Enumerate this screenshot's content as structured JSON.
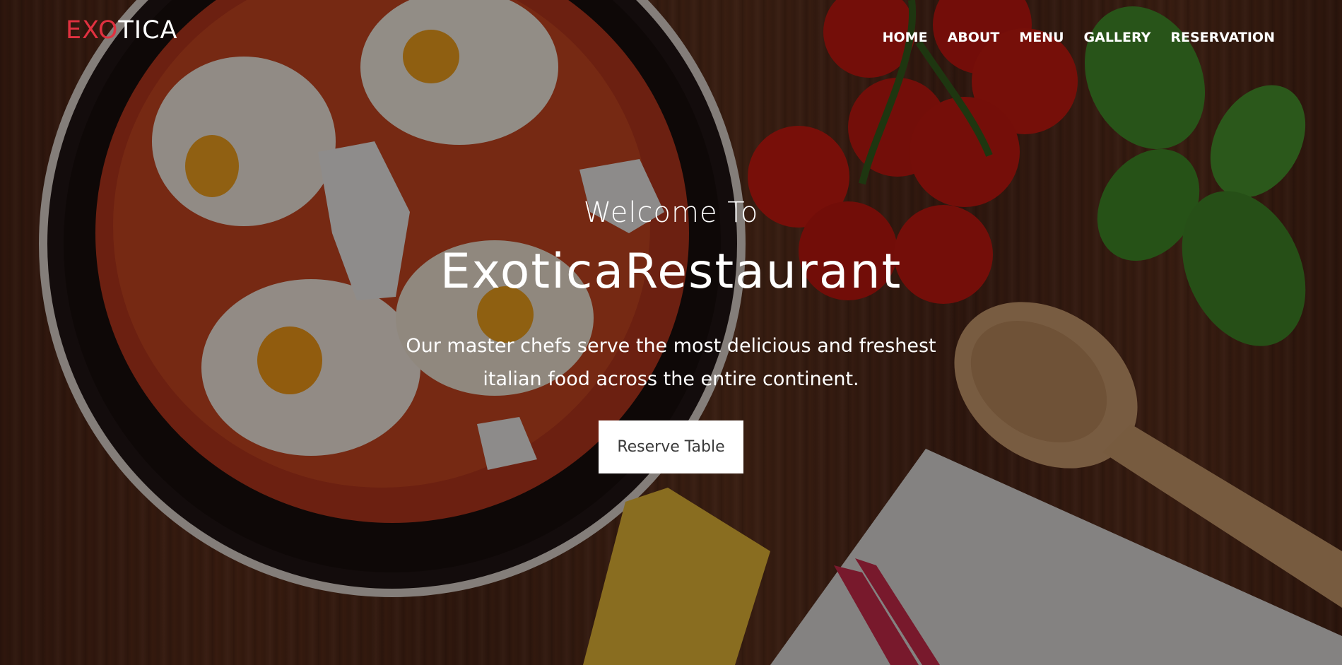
{
  "logo": {
    "accent": "EXO",
    "rest": "TICA"
  },
  "nav": {
    "items": [
      {
        "label": "HOME"
      },
      {
        "label": "ABOUT"
      },
      {
        "label": "MENU"
      },
      {
        "label": "GALLERY"
      },
      {
        "label": "RESERVATION"
      }
    ]
  },
  "hero": {
    "welcome": "Welcome To",
    "title": "ExoticaRestaurant",
    "description_line1": "Our master chefs serve the most delicious and freshest",
    "description_line2": "italian food across the entire continent.",
    "button_label": "Reserve Table"
  },
  "colors": {
    "accent": "#e03140",
    "text": "#ffffff",
    "button_bg": "#ffffff",
    "button_text": "#3a3a3a"
  }
}
